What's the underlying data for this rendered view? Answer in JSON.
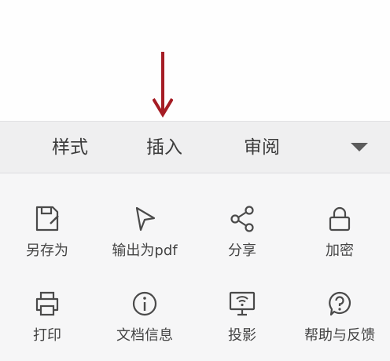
{
  "tabs": {
    "style_label": "样式",
    "insert_label": "插入",
    "review_label": "审阅",
    "toggle_icon": "triangle-down-icon"
  },
  "actions": {
    "row1": [
      {
        "label": "另存为",
        "icon": "save-as-icon"
      },
      {
        "label": "输出为pdf",
        "icon": "export-pdf-icon"
      },
      {
        "label": "分享",
        "icon": "share-icon"
      },
      {
        "label": "加密",
        "icon": "lock-icon"
      }
    ],
    "row2": [
      {
        "label": "打印",
        "icon": "printer-icon"
      },
      {
        "label": "文档信息",
        "icon": "info-icon"
      },
      {
        "label": "投影",
        "icon": "screen-cast-icon"
      },
      {
        "label": "帮助与反馈",
        "icon": "help-icon"
      }
    ]
  },
  "colors": {
    "arrow": "#a51c24",
    "icon": "#4a4a4a",
    "tabbar_bg": "#efeff0",
    "panel_bg": "#f6f6f7"
  }
}
